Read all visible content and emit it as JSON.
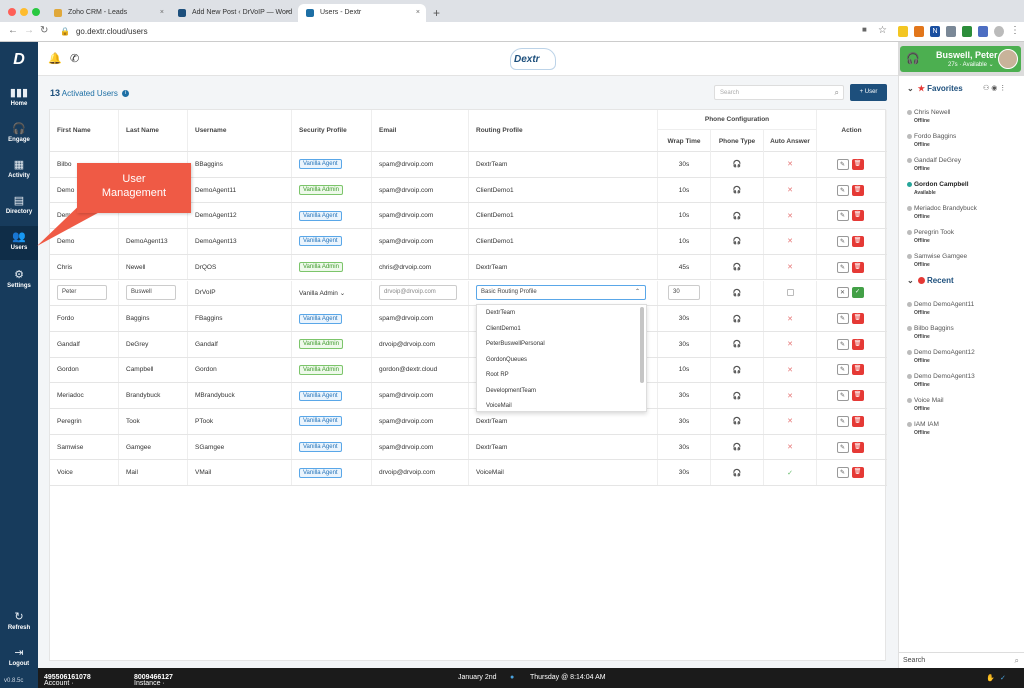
{
  "browser": {
    "tabs": [
      {
        "label": "Zoho CRM - Leads",
        "color": "#e0a83a"
      },
      {
        "label": "Add New Post ‹ DrVoIP — Word",
        "color": "#1d4f7c"
      },
      {
        "label": "Users - Dextr",
        "color": "#1d6fa5"
      }
    ],
    "url": "go.dextr.cloud/users"
  },
  "nav": {
    "items": [
      {
        "label": "Home",
        "icon": "bar-chart-icon"
      },
      {
        "label": "Engage",
        "icon": "headset-icon"
      },
      {
        "label": "Activity",
        "icon": "calendar-icon"
      },
      {
        "label": "Directory",
        "icon": "contacts-book-icon"
      },
      {
        "label": "Users",
        "icon": "users-icon"
      },
      {
        "label": "Settings",
        "icon": "gears-icon"
      },
      {
        "label": "Refresh",
        "icon": "refresh-icon"
      },
      {
        "label": "Logout",
        "icon": "logout-icon"
      }
    ],
    "version": "v0.8.5c"
  },
  "header": {
    "brand": "Dextr"
  },
  "user": {
    "name": "Buswell, Peter",
    "status": "27s · Available"
  },
  "main": {
    "count": "13",
    "count_label": "Activated Users",
    "search_placeholder": "Search",
    "add_user_label": "+ User"
  },
  "table": {
    "headers": {
      "first": "First Name",
      "last": "Last Name",
      "username": "Username",
      "security": "Security Profile",
      "email": "Email",
      "routing": "Routing Profile",
      "phone_config": "Phone Configuration",
      "wrap": "Wrap Time",
      "phone_type": "Phone Type",
      "auto_answer": "Auto Answer",
      "action": "Action"
    },
    "rows": [
      {
        "first": "Bilbo",
        "last": "",
        "username": "BBaggins",
        "security": "Vanilla Agent",
        "email": "spam@drvoip.com",
        "routing": "DextrTeam",
        "wrap": "30s",
        "auto": false
      },
      {
        "first": "Demo",
        "last": "",
        "username": "DemoAgent11",
        "security": "Vanilla Admin",
        "email": "spam@drvoip.com",
        "routing": "ClientDemo1",
        "wrap": "10s",
        "auto": false
      },
      {
        "first": "Demo",
        "last": "",
        "username": "DemoAgent12",
        "security": "Vanilla Agent",
        "email": "spam@drvoip.com",
        "routing": "ClientDemo1",
        "wrap": "10s",
        "auto": false
      },
      {
        "first": "Demo",
        "last": "DemoAgent13",
        "username": "DemoAgent13",
        "security": "Vanilla Agent",
        "email": "spam@drvoip.com",
        "routing": "ClientDemo1",
        "wrap": "10s",
        "auto": false
      },
      {
        "first": "Chris",
        "last": "Newell",
        "username": "DrQOS",
        "security": "Vanilla Admin",
        "email": "chris@drvoip.com",
        "routing": "DextrTeam",
        "wrap": "45s",
        "auto": false
      },
      {
        "first": "Fordo",
        "last": "Baggins",
        "username": "FBaggins",
        "security": "Vanilla Agent",
        "email": "spam@drvoip.com",
        "routing": "",
        "wrap": "30s",
        "auto": false
      },
      {
        "first": "Gandalf",
        "last": "DeGrey",
        "username": "Gandalf",
        "security": "Vanilla Admin",
        "email": "drvoip@drvoip.com",
        "routing": "",
        "wrap": "30s",
        "auto": false
      },
      {
        "first": "Gordon",
        "last": "Campbell",
        "username": "Gordon",
        "security": "Vanilla Admin",
        "email": "gordon@dextr.cloud",
        "routing": "",
        "wrap": "10s",
        "auto": false
      },
      {
        "first": "Meriadoc",
        "last": "Brandybuck",
        "username": "MBrandybuck",
        "security": "Vanilla Agent",
        "email": "spam@drvoip.com",
        "routing": "",
        "wrap": "30s",
        "auto": false
      },
      {
        "first": "Peregrin",
        "last": "Took",
        "username": "PTook",
        "security": "Vanilla Agent",
        "email": "spam@drvoip.com",
        "routing": "DextrTeam",
        "wrap": "30s",
        "auto": false
      },
      {
        "first": "Samwise",
        "last": "Gamgee",
        "username": "SGamgee",
        "security": "Vanilla Agent",
        "email": "spam@drvoip.com",
        "routing": "DextrTeam",
        "wrap": "30s",
        "auto": false
      },
      {
        "first": "Voice",
        "last": "Mail",
        "username": "VMail",
        "security": "Vanilla Agent",
        "email": "drvoip@drvoip.com",
        "routing": "VoiceMail",
        "wrap": "30s",
        "auto": true
      }
    ],
    "edit_row": {
      "first": "Peter",
      "last": "Buswell",
      "username": "DrVoIP",
      "security": "Vanilla Admin",
      "email": "drvoip@drvoip.com",
      "routing": "Basic Routing Profile",
      "wrap": "30"
    },
    "routing_options": [
      "DextrTeam",
      "ClientDemo1",
      "PeterBuswellPersonal",
      "GordonQueues",
      "Root RP",
      "DevelopmentTeam",
      "VoiceMail"
    ]
  },
  "callout": {
    "line1": "User",
    "line2": "Management"
  },
  "panel": {
    "favorites_title": "Favorites",
    "favorites": [
      {
        "name": "Chris Newell",
        "status": "Offline",
        "online": false
      },
      {
        "name": "Fordo Baggins",
        "status": "Offline",
        "online": false
      },
      {
        "name": "Gandalf DeGrey",
        "status": "Offline",
        "online": false
      },
      {
        "name": "Gordon Campbell",
        "status": "Available",
        "online": true
      },
      {
        "name": "Meriadoc Brandybuck",
        "status": "Offline",
        "online": false
      },
      {
        "name": "Peregrin Took",
        "status": "Offline",
        "online": false
      },
      {
        "name": "Samwise Gamgee",
        "status": "Offline",
        "online": false
      }
    ],
    "recent_title": "Recent",
    "recent": [
      {
        "name": "Demo DemoAgent11",
        "status": "Offline"
      },
      {
        "name": "Bilbo Baggins",
        "status": "Offline"
      },
      {
        "name": "Demo DemoAgent12",
        "status": "Offline"
      },
      {
        "name": "Demo DemoAgent13",
        "status": "Offline"
      },
      {
        "name": "Voice Mail",
        "status": "Offline"
      },
      {
        "name": "IAM IAM",
        "status": "Offline"
      }
    ],
    "search_label": "Search"
  },
  "footer": {
    "account_label": "Account · ",
    "account": "495506161078",
    "instance_label": "Instance · ",
    "instance": "8009466127",
    "date": "January 2nd",
    "time": "Thursday @ 8:14:04 AM"
  }
}
